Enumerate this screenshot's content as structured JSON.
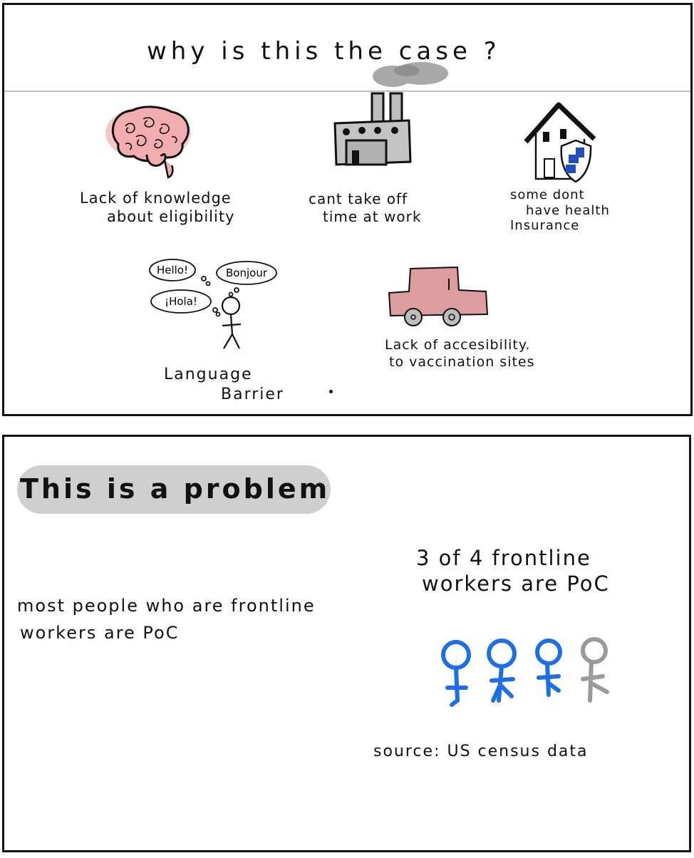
{
  "panel1": {
    "title": "why is this the case ?",
    "reasons": {
      "knowledge": [
        "Lack of knowledge",
        "about eligibility"
      ],
      "work": [
        "cant take off",
        "time at work"
      ],
      "insurance": [
        "some dont",
        "have health",
        "Insurance"
      ],
      "language": [
        "Language",
        "Barrier"
      ],
      "access": [
        "Lack of accesibility.",
        "to vaccination sites"
      ]
    },
    "speech_bubbles": [
      "Hello!",
      "Bonjour",
      "¡Hola!"
    ]
  },
  "panel2": {
    "heading": "This is a problem",
    "body_lines": [
      "most people who are frontline",
      "workers are PoC"
    ],
    "stat_lines": [
      "3 of 4 frontline",
      "workers are PoC"
    ],
    "people_shown": {
      "highlighted": 3,
      "total": 4,
      "highlight_color": "#1e6fe6",
      "other_color": "#9a9a9a"
    },
    "source": "source: US census data"
  }
}
